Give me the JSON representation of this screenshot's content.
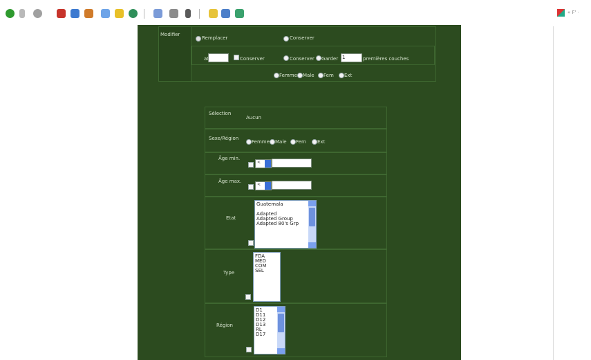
{
  "toolbar": {
    "icons": [
      "back-icon",
      "forward-icon",
      "stop-icon",
      "refresh-icon",
      "home-icon",
      "search-icon",
      "favorites-icon",
      "media-icon",
      "history-icon",
      "mail-icon",
      "print-icon",
      "edit-icon",
      "discuss-icon",
      "messenger-icon"
    ]
  },
  "side": {
    "text": "« F' ·"
  },
  "top": {
    "section_label": "Modifier",
    "opt1": "Remplacer",
    "opt2": "Conserver",
    "pos_prefix": "at",
    "pos_value": "",
    "opt_prefix": "Conserver",
    "opt_complete": "Conserver",
    "opt_keep": "Garder",
    "keep_value": "1",
    "keep_suffix": "premières couches",
    "sex_options": [
      "Femme",
      "Male",
      "Fem",
      "Ext"
    ]
  },
  "form": {
    "selection_label": "Sélection",
    "selection_value": "Aucun",
    "gender_label": "Sexe/Région",
    "gender_options": [
      "Femme",
      "Male",
      "Fem",
      "Ext"
    ],
    "age_min_label": "Âge min.",
    "age_min_op": "<",
    "age_min_value": "",
    "age_max_label": "Âge max.",
    "age_max_op": "<",
    "age_max_value": "",
    "list1_label": "Etat",
    "list1_items": [
      "Guatemala",
      "",
      "Adapted",
      "Adapted Group",
      "Adapted 80's Grp"
    ],
    "list2_label": "Type",
    "list2_items": [
      "FDA",
      "MED",
      "COM",
      "SEL"
    ],
    "list3_label": "Région",
    "list3_items": [
      "D1",
      "D11",
      "D12",
      "D13",
      "RL",
      "D17"
    ]
  }
}
